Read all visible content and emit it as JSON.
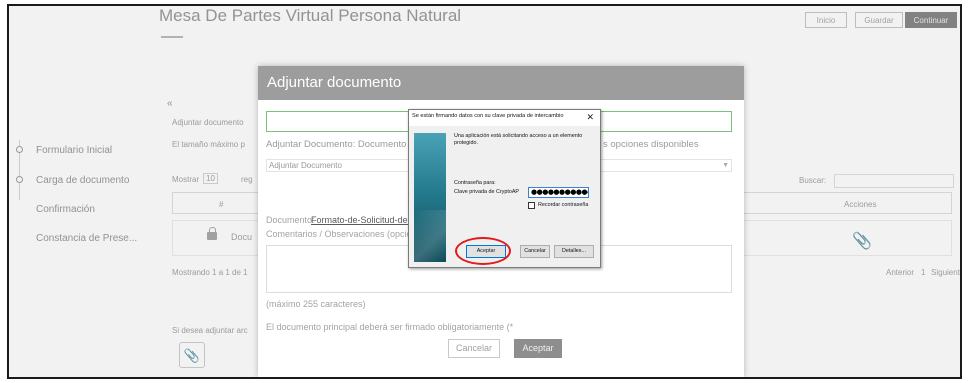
{
  "background": {
    "title": "Mesa De Partes Virtual Persona Natural",
    "top_buttons": [
      "Inicio",
      "Guardar",
      "Continuar"
    ],
    "back_arrow": "«",
    "section_text_1": "Adjuntar documento",
    "section_text_2": "El tamaño máximo p",
    "show_label": "Mostrar",
    "show_value": "10",
    "show_suffix": "reg",
    "filter_label": "Buscar:",
    "table_header_col": "#",
    "table_header_actions": "Acciones",
    "doc_text": "Docu",
    "records_text": "Mostrando 1 a 1 de 1",
    "pagination": [
      "Anterior",
      "1",
      "Siguiente"
    ],
    "attach_hint": "Si desea adjuntar arc",
    "steps": [
      "Formulario Inicial",
      "Carga de documento",
      "Confirmación",
      "Constancia de Prese..."
    ],
    "attach_icon": "paperclip-icon",
    "lock_icon": "lock-icon"
  },
  "modal": {
    "title": "Adjuntar documento",
    "doc_label": "Adjuntar Documento: Documento",
    "options_text": "s opciones disponibles",
    "select_value": "Adjuntar Documento",
    "document_label": "Documento:",
    "document_link": "Formato-de-Solicitud-de-ll",
    "comments_label": "Comentarios / Observaciones (opcional)",
    "max_chars": "(máximo 255 caracteres)",
    "signed_note": "El documento principal deberá ser firmado obligatoriamente (*",
    "cancel_label": "Cancelar",
    "accept_label": "Aceptar"
  },
  "dialog": {
    "title": "Se están firmando datos con su clave privada de intercambio",
    "close_glyph": "✕",
    "message_line1": "Una aplicación está solicitando acceso a un elemento",
    "message_line2": "protegido.",
    "password_for": "Contraseña para:",
    "password_label": "Clave privada de CryptoAP",
    "password_value": "●●●●●●●●●●●",
    "remember_label": "Recordar contraseña",
    "accept_label": "Aceptar",
    "cancel_label": "Cancelar",
    "details_label": "Detalles..."
  },
  "colors": {
    "modal_header": "#9d9d9d",
    "highlight_ring": "#e01b1b",
    "dialog_focus": "#0078d7"
  }
}
